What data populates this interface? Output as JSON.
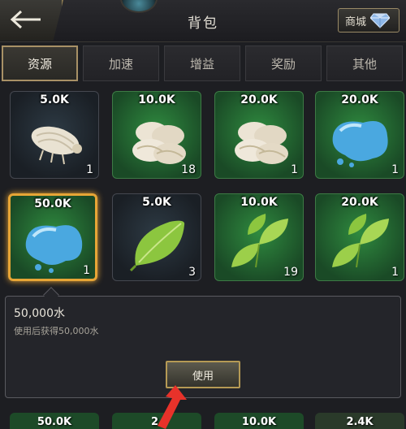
{
  "header": {
    "title": "背包",
    "shop_label": "商城"
  },
  "tabs": [
    {
      "label": "资源",
      "active": true
    },
    {
      "label": "加速",
      "active": false
    },
    {
      "label": "增益",
      "active": false
    },
    {
      "label": "奖励",
      "active": false
    },
    {
      "label": "其他",
      "active": false
    }
  ],
  "items": [
    {
      "value": "5.0K",
      "count": "1",
      "kind": "food",
      "bg": "dark"
    },
    {
      "value": "10.0K",
      "count": "18",
      "kind": "food",
      "bg": "green"
    },
    {
      "value": "20.0K",
      "count": "1",
      "kind": "food",
      "bg": "green"
    },
    {
      "value": "20.0K",
      "count": "1",
      "kind": "water",
      "bg": "green"
    },
    {
      "value": "50.0K",
      "count": "1",
      "kind": "water",
      "bg": "green",
      "selected": true
    },
    {
      "value": "5.0K",
      "count": "3",
      "kind": "leaf",
      "bg": "dark"
    },
    {
      "value": "10.0K",
      "count": "19",
      "kind": "leaf",
      "bg": "green"
    },
    {
      "value": "20.0K",
      "count": "1",
      "kind": "leaf",
      "bg": "green"
    }
  ],
  "detail": {
    "title": "50,000水",
    "description": "使用后获得50,000水",
    "use_label": "使用"
  },
  "bottom_row": [
    "50.0K",
    "2.",
    "10.0K",
    "2.4K"
  ],
  "colors": {
    "accent_gold": "#a89166",
    "selected_border": "#e7a536",
    "green_cell": "#2f8a3f",
    "arrow_red": "#e8322a"
  }
}
